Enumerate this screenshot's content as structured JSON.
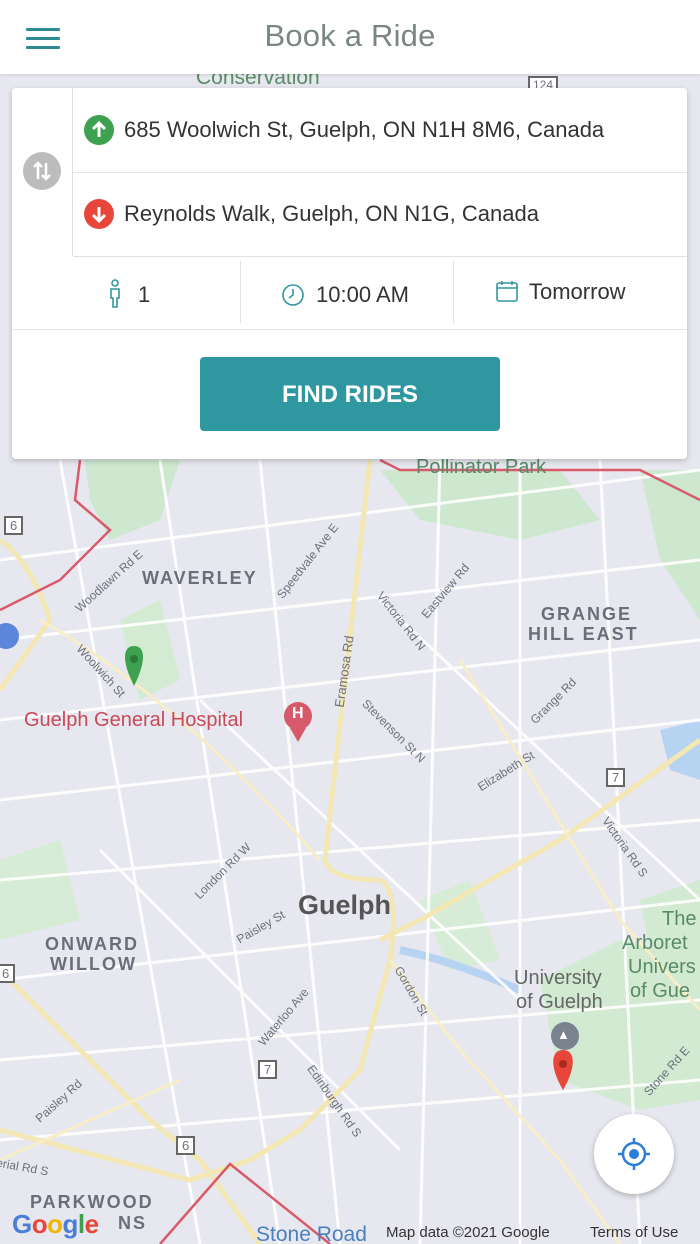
{
  "header": {
    "title": "Book a Ride",
    "menu_icon": "hamburger-menu-icon"
  },
  "search": {
    "from_address": "685 Woolwich St, Guelph, ON N1H 8M6, Canada",
    "to_address": "Reynolds Walk, Guelph, ON N1G, Canada",
    "passengers": "1",
    "time": "10:00 AM",
    "date": "Tomorrow",
    "find_button": "FIND RIDES"
  },
  "map": {
    "labels": {
      "conservation": "Conservation",
      "pollinator_park": "Pollinator Park",
      "waverley": "WAVERLEY",
      "grange": "GRANGE",
      "hill_east": "HILL EAST",
      "hospital": "Guelph General Hospital",
      "guelph": "Guelph",
      "onward": "ONWARD",
      "willow": "WILLOW",
      "university": "University",
      "of_guelph": "of Guelph",
      "arboretum_1": "The",
      "arboretum_2": "Arboret",
      "arboretum_3": "Univers",
      "arboretum_4": "of Gue",
      "parkwood": "PARKWOOD",
      "ns": "NS",
      "stone_road": "Stone Road"
    },
    "streets": {
      "woodlawn": "Woodlawn Rd E",
      "woolwich": "Woolwich St",
      "speedvale": "Speedvale Ave E",
      "victoria_n": "Victoria Rd N",
      "eastview": "Eastview Rd",
      "eramosa": "Eramosa Rd",
      "stevenson": "Stevenson St N",
      "grange_rd": "Grange Rd",
      "elizabeth": "Elizabeth St",
      "victoria_s": "Victoria Rd S",
      "london": "London Rd W",
      "paisley_st": "Paisley St",
      "waterloo": "Waterloo Ave",
      "gordon": "Gordon St",
      "edinburgh": "Edinburgh Rd S",
      "paisley_rd": "Paisley Rd",
      "stone_e": "Stone Rd E",
      "erial": "erial Rd S"
    },
    "shields": {
      "hwy_6_a": "6",
      "hwy_6_b": "6",
      "hwy_6_c": "6",
      "hwy_7_a": "7",
      "hwy_7_b": "7",
      "hwy_124": "124"
    },
    "attribution": {
      "google": "Google",
      "data": "Map data ©2021 Google",
      "terms": "Terms of Use"
    }
  },
  "colors": {
    "accent": "#2f97a0",
    "pickup": "#3ea14f",
    "dropoff": "#e8463a"
  }
}
